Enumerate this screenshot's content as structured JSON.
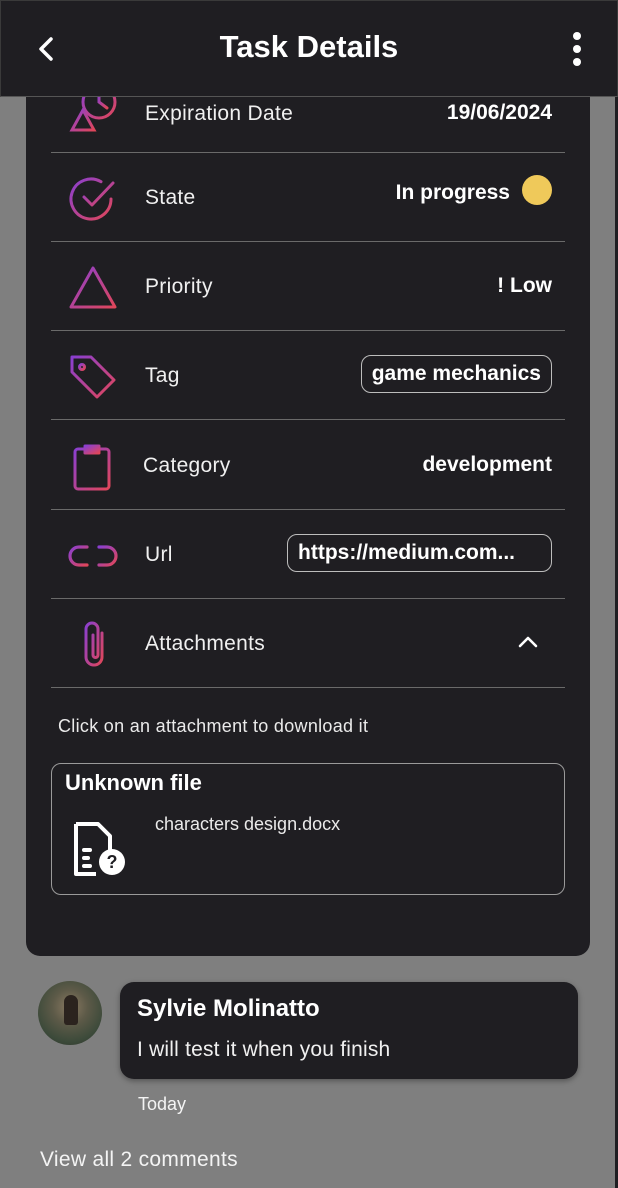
{
  "header": {
    "title": "Task Details",
    "back_icon": "chevron-left-icon",
    "menu_icon": "kebab-menu-icon"
  },
  "details": {
    "expiration": {
      "label": "Expiration Date",
      "value": "19/06/2024"
    },
    "state": {
      "label": "State",
      "value": "In progress",
      "status_color": "#efc95a"
    },
    "priority": {
      "label": "Priority",
      "value": "! Low"
    },
    "tag": {
      "label": "Tag",
      "value": "game mechanics"
    },
    "category": {
      "label": "Category",
      "value": "development"
    },
    "url": {
      "label": "Url",
      "value": "https://medium.com..."
    },
    "attachments": {
      "label": "Attachments",
      "expanded": true
    }
  },
  "attachments_hint": "Click on an attachment to download it",
  "attachment": {
    "title": "Unknown file",
    "filename": "characters design.docx",
    "icon": "unknown-file-icon"
  },
  "comment": {
    "author": "Sylvie Molinatto",
    "text": "I will test it when you finish",
    "time": "Today"
  },
  "view_all": "View all 2 comments",
  "colors": {
    "background": "#7f7f7f",
    "card": "#1f1e22",
    "gradient_start": "#8a3fd0",
    "gradient_end": "#e0465a"
  }
}
